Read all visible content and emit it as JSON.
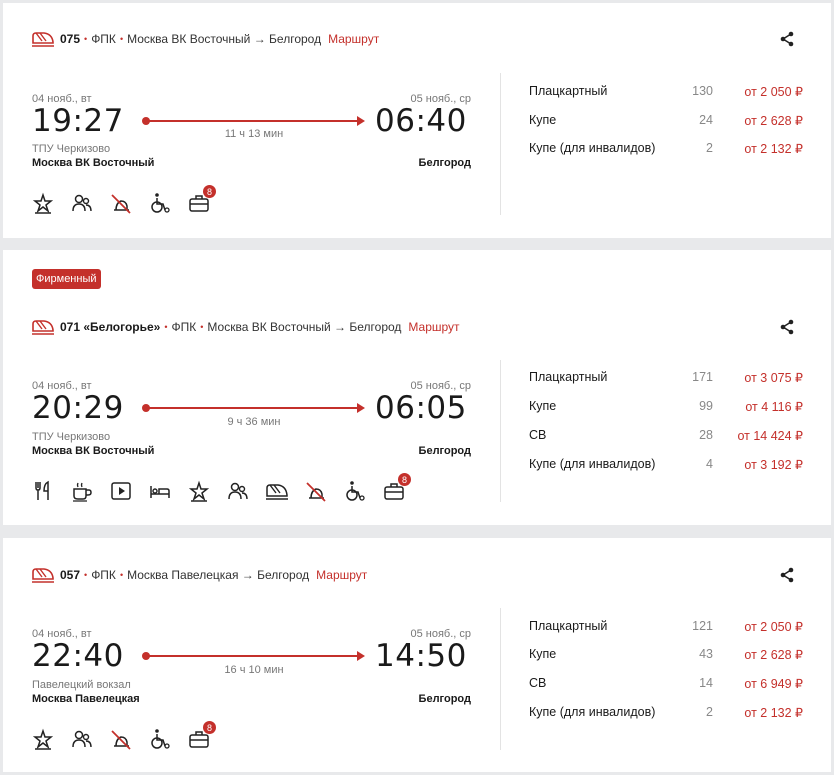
{
  "colors": {
    "accent": "#c4302b",
    "background": "#e8e9eb"
  },
  "trains": [
    {
      "number": "075",
      "name": "",
      "carrier": "ФПК",
      "route": "Москва ВК Восточный → Белгород",
      "route_link": "Маршрут",
      "badge": "",
      "dep_date": "04 нояб., вт",
      "dep_time": "19:27",
      "arr_date": "05 нояб., ср",
      "arr_time": "06:40",
      "duration": "11 ч 13 мин",
      "dep_station_small": "ТПУ Черкизово",
      "dep_station": "Москва ВК Восточный",
      "arr_station": "Белгород",
      "amenities": [
        "star-icon",
        "passengers-icon",
        "no-pets-icon",
        "wheelchair-icon",
        "luggage-icon"
      ],
      "luggage_count": "8",
      "fares": [
        {
          "class": "Плацкартный",
          "seats": "130",
          "price": "от 2 050 ₽"
        },
        {
          "class": "Купе",
          "seats": "24",
          "price": "от 2 628 ₽"
        },
        {
          "class": "Купе (для инвалидов)",
          "seats": "2",
          "price": "от 2 132 ₽"
        }
      ]
    },
    {
      "number": "071 «Белогорье»",
      "carrier": "ФПК",
      "route": "Москва ВК Восточный → Белгород",
      "route_link": "Маршрут",
      "badge": "Фирменный",
      "dep_date": "04 нояб., вт",
      "dep_time": "20:29",
      "arr_date": "05 нояб., ср",
      "arr_time": "06:05",
      "duration": "9 ч 36 мин",
      "dep_station_small": "ТПУ Черкизово",
      "dep_station": "Москва ВК Восточный",
      "arr_station": "Белгород",
      "amenities": [
        "restaurant-icon",
        "coffee-icon",
        "video-icon",
        "bed-icon",
        "star-icon",
        "passengers-icon",
        "train-icon",
        "no-pets-icon",
        "wheelchair-icon",
        "luggage-icon"
      ],
      "luggage_count": "8",
      "fares": [
        {
          "class": "Плацкартный",
          "seats": "171",
          "price": "от 3 075 ₽"
        },
        {
          "class": "Купе",
          "seats": "99",
          "price": "от 4 116 ₽"
        },
        {
          "class": "СВ",
          "seats": "28",
          "price": "от 14 424 ₽"
        },
        {
          "class": "Купе (для инвалидов)",
          "seats": "4",
          "price": "от 3 192 ₽"
        }
      ]
    },
    {
      "number": "057",
      "carrier": "ФПК",
      "route": "Москва Павелецкая → Белгород",
      "route_link": "Маршрут",
      "badge": "",
      "dep_date": "04 нояб., вт",
      "dep_time": "22:40",
      "arr_date": "05 нояб., ср",
      "arr_time": "14:50",
      "duration": "16 ч 10 мин",
      "dep_station_small": "Павелецкий вокзал",
      "dep_station": "Москва Павелецкая",
      "arr_station": "Белгород",
      "amenities": [
        "star-icon",
        "passengers-icon",
        "no-pets-icon",
        "wheelchair-icon",
        "luggage-icon"
      ],
      "luggage_count": "8",
      "fares": [
        {
          "class": "Плацкартный",
          "seats": "121",
          "price": "от 2 050 ₽"
        },
        {
          "class": "Купе",
          "seats": "43",
          "price": "от 2 628 ₽"
        },
        {
          "class": "СВ",
          "seats": "14",
          "price": "от 6 949 ₽"
        },
        {
          "class": "Купе (для инвалидов)",
          "seats": "2",
          "price": "от 2 132 ₽"
        }
      ]
    }
  ]
}
